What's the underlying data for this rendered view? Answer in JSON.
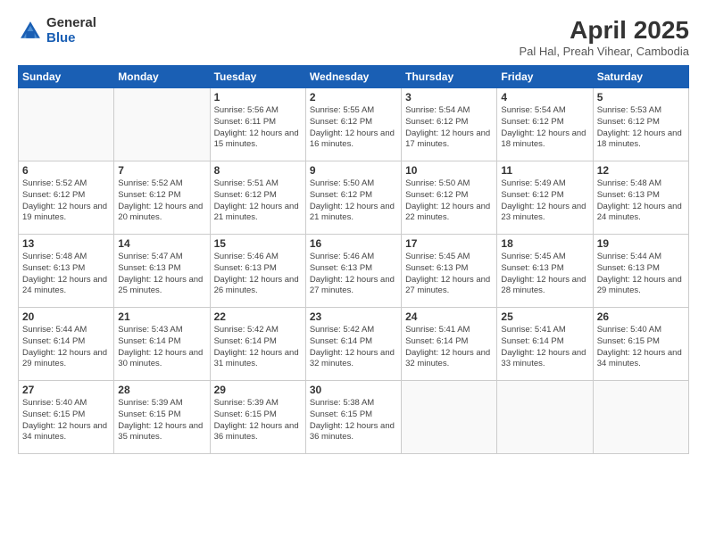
{
  "logo": {
    "general": "General",
    "blue": "Blue"
  },
  "title": "April 2025",
  "subtitle": "Pal Hal, Preah Vihear, Cambodia",
  "days_of_week": [
    "Sunday",
    "Monday",
    "Tuesday",
    "Wednesday",
    "Thursday",
    "Friday",
    "Saturday"
  ],
  "weeks": [
    [
      {
        "day": "",
        "info": ""
      },
      {
        "day": "",
        "info": ""
      },
      {
        "day": "1",
        "info": "Sunrise: 5:56 AM\nSunset: 6:11 PM\nDaylight: 12 hours and 15 minutes."
      },
      {
        "day": "2",
        "info": "Sunrise: 5:55 AM\nSunset: 6:12 PM\nDaylight: 12 hours and 16 minutes."
      },
      {
        "day": "3",
        "info": "Sunrise: 5:54 AM\nSunset: 6:12 PM\nDaylight: 12 hours and 17 minutes."
      },
      {
        "day": "4",
        "info": "Sunrise: 5:54 AM\nSunset: 6:12 PM\nDaylight: 12 hours and 18 minutes."
      },
      {
        "day": "5",
        "info": "Sunrise: 5:53 AM\nSunset: 6:12 PM\nDaylight: 12 hours and 18 minutes."
      }
    ],
    [
      {
        "day": "6",
        "info": "Sunrise: 5:52 AM\nSunset: 6:12 PM\nDaylight: 12 hours and 19 minutes."
      },
      {
        "day": "7",
        "info": "Sunrise: 5:52 AM\nSunset: 6:12 PM\nDaylight: 12 hours and 20 minutes."
      },
      {
        "day": "8",
        "info": "Sunrise: 5:51 AM\nSunset: 6:12 PM\nDaylight: 12 hours and 21 minutes."
      },
      {
        "day": "9",
        "info": "Sunrise: 5:50 AM\nSunset: 6:12 PM\nDaylight: 12 hours and 21 minutes."
      },
      {
        "day": "10",
        "info": "Sunrise: 5:50 AM\nSunset: 6:12 PM\nDaylight: 12 hours and 22 minutes."
      },
      {
        "day": "11",
        "info": "Sunrise: 5:49 AM\nSunset: 6:12 PM\nDaylight: 12 hours and 23 minutes."
      },
      {
        "day": "12",
        "info": "Sunrise: 5:48 AM\nSunset: 6:13 PM\nDaylight: 12 hours and 24 minutes."
      }
    ],
    [
      {
        "day": "13",
        "info": "Sunrise: 5:48 AM\nSunset: 6:13 PM\nDaylight: 12 hours and 24 minutes."
      },
      {
        "day": "14",
        "info": "Sunrise: 5:47 AM\nSunset: 6:13 PM\nDaylight: 12 hours and 25 minutes."
      },
      {
        "day": "15",
        "info": "Sunrise: 5:46 AM\nSunset: 6:13 PM\nDaylight: 12 hours and 26 minutes."
      },
      {
        "day": "16",
        "info": "Sunrise: 5:46 AM\nSunset: 6:13 PM\nDaylight: 12 hours and 27 minutes."
      },
      {
        "day": "17",
        "info": "Sunrise: 5:45 AM\nSunset: 6:13 PM\nDaylight: 12 hours and 27 minutes."
      },
      {
        "day": "18",
        "info": "Sunrise: 5:45 AM\nSunset: 6:13 PM\nDaylight: 12 hours and 28 minutes."
      },
      {
        "day": "19",
        "info": "Sunrise: 5:44 AM\nSunset: 6:13 PM\nDaylight: 12 hours and 29 minutes."
      }
    ],
    [
      {
        "day": "20",
        "info": "Sunrise: 5:44 AM\nSunset: 6:14 PM\nDaylight: 12 hours and 29 minutes."
      },
      {
        "day": "21",
        "info": "Sunrise: 5:43 AM\nSunset: 6:14 PM\nDaylight: 12 hours and 30 minutes."
      },
      {
        "day": "22",
        "info": "Sunrise: 5:42 AM\nSunset: 6:14 PM\nDaylight: 12 hours and 31 minutes."
      },
      {
        "day": "23",
        "info": "Sunrise: 5:42 AM\nSunset: 6:14 PM\nDaylight: 12 hours and 32 minutes."
      },
      {
        "day": "24",
        "info": "Sunrise: 5:41 AM\nSunset: 6:14 PM\nDaylight: 12 hours and 32 minutes."
      },
      {
        "day": "25",
        "info": "Sunrise: 5:41 AM\nSunset: 6:14 PM\nDaylight: 12 hours and 33 minutes."
      },
      {
        "day": "26",
        "info": "Sunrise: 5:40 AM\nSunset: 6:15 PM\nDaylight: 12 hours and 34 minutes."
      }
    ],
    [
      {
        "day": "27",
        "info": "Sunrise: 5:40 AM\nSunset: 6:15 PM\nDaylight: 12 hours and 34 minutes."
      },
      {
        "day": "28",
        "info": "Sunrise: 5:39 AM\nSunset: 6:15 PM\nDaylight: 12 hours and 35 minutes."
      },
      {
        "day": "29",
        "info": "Sunrise: 5:39 AM\nSunset: 6:15 PM\nDaylight: 12 hours and 36 minutes."
      },
      {
        "day": "30",
        "info": "Sunrise: 5:38 AM\nSunset: 6:15 PM\nDaylight: 12 hours and 36 minutes."
      },
      {
        "day": "",
        "info": ""
      },
      {
        "day": "",
        "info": ""
      },
      {
        "day": "",
        "info": ""
      }
    ]
  ]
}
